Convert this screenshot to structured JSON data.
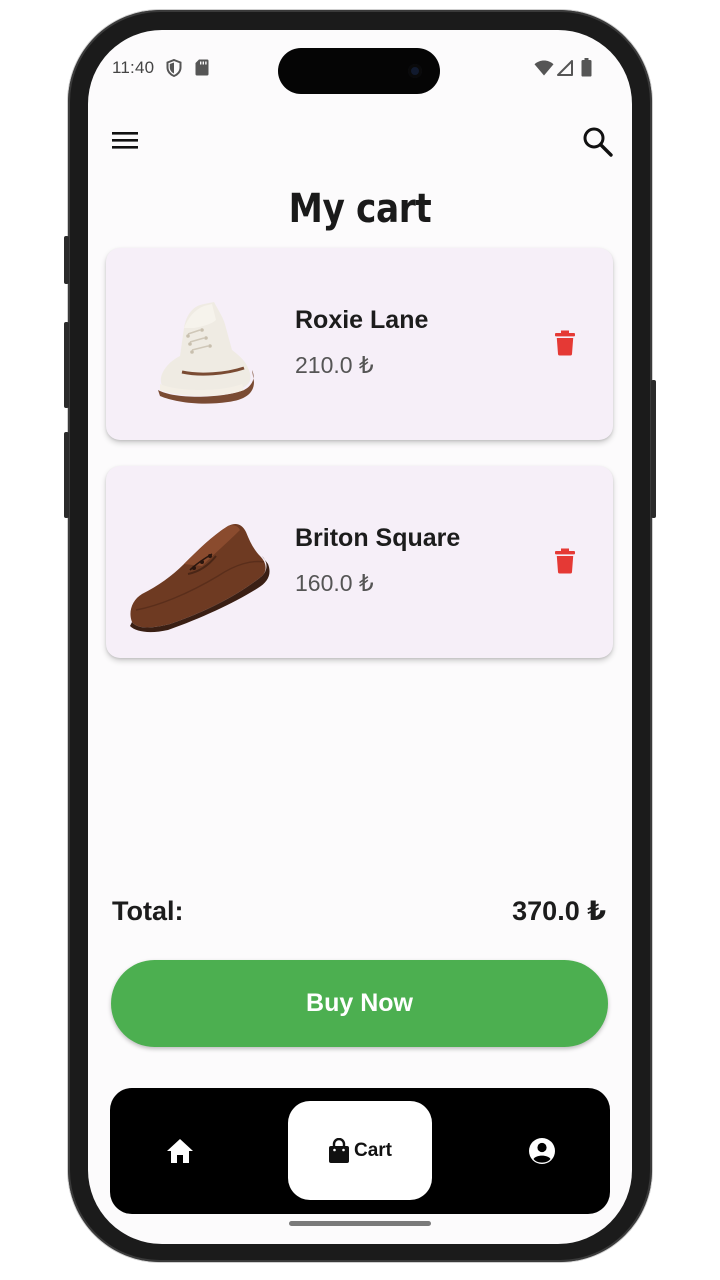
{
  "status_bar": {
    "time": "11:40",
    "left_icons": [
      "shield-icon",
      "sd-card-icon"
    ],
    "right_icons": [
      "wifi-icon",
      "signal-icon",
      "battery-icon"
    ]
  },
  "top_bar": {
    "menu_icon": "menu-icon",
    "search_icon": "search-icon"
  },
  "page": {
    "title": "My cart"
  },
  "cart": {
    "items": [
      {
        "name": "Roxie Lane",
        "price": "210.0 ₺",
        "image": "white-boot-image",
        "delete_icon": "trash-icon"
      },
      {
        "name": "Briton Square",
        "price": "160.0 ₺",
        "image": "brown-shoe-image",
        "delete_icon": "trash-icon"
      }
    ],
    "total_label": "Total:",
    "total_value": "370.0 ₺",
    "buy_label": "Buy Now"
  },
  "bottom_nav": {
    "items": [
      {
        "icon": "home-icon",
        "label": ""
      },
      {
        "icon": "shopping-bag-icon",
        "label": "Cart",
        "active": true
      },
      {
        "icon": "account-circle-icon",
        "label": ""
      }
    ]
  },
  "colors": {
    "accent": "#4caf50",
    "card_background": "#f6eff8",
    "delete": "#e53935",
    "nav_background": "#000000"
  }
}
